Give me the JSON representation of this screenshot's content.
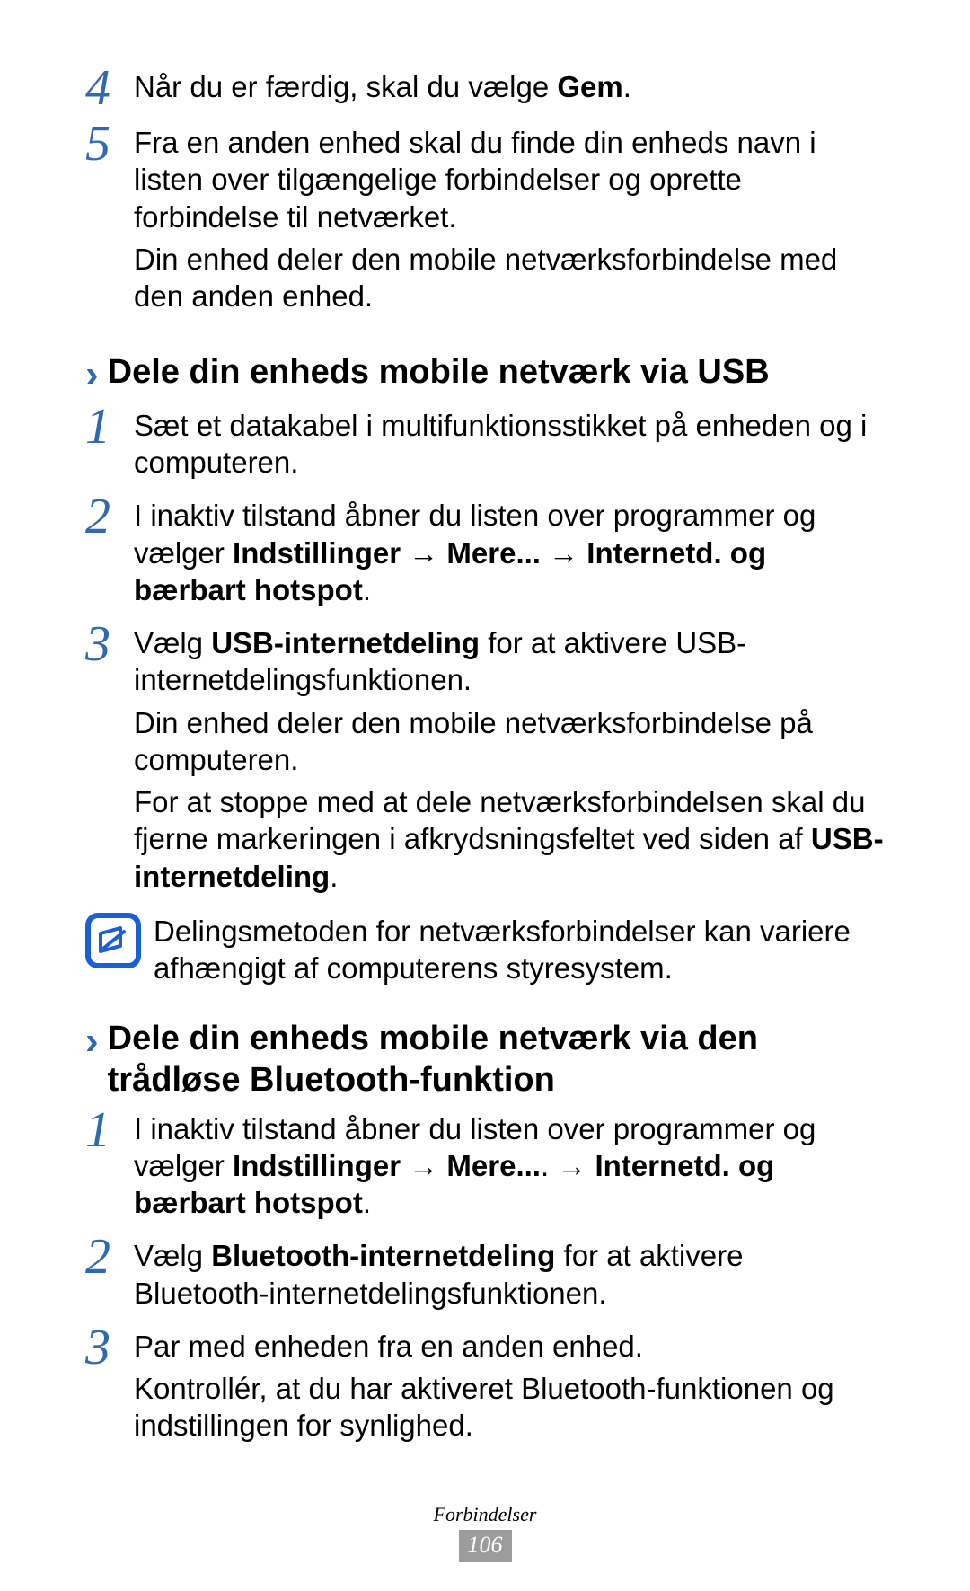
{
  "top_steps": [
    {
      "num": "4",
      "paras": [
        {
          "runs": [
            {
              "t": "Når du er færdig, skal du vælge "
            },
            {
              "t": "Gem",
              "b": true
            },
            {
              "t": "."
            }
          ]
        }
      ]
    },
    {
      "num": "5",
      "paras": [
        {
          "runs": [
            {
              "t": "Fra en anden enhed skal du finde din enheds navn i listen over tilgængelige forbindelser og oprette forbindelse til netværket."
            }
          ]
        },
        {
          "runs": [
            {
              "t": "Din enhed deler den mobile netværksforbindelse med den anden enhed."
            }
          ]
        }
      ]
    }
  ],
  "section1": {
    "title": "Dele din enheds mobile netværk via USB",
    "steps": [
      {
        "num": "1",
        "paras": [
          {
            "runs": [
              {
                "t": "Sæt et datakabel i multifunktionsstikket på enheden og i computeren."
              }
            ]
          }
        ]
      },
      {
        "num": "2",
        "paras": [
          {
            "runs": [
              {
                "t": "I inaktiv tilstand åbner du listen over programmer og vælger "
              },
              {
                "t": "Indstillinger",
                "b": true
              },
              {
                "t": " → "
              },
              {
                "t": "Mere...",
                "b": true
              },
              {
                "t": " → "
              },
              {
                "t": "Internetd. og bærbart hotspot",
                "b": true
              },
              {
                "t": "."
              }
            ]
          }
        ]
      },
      {
        "num": "3",
        "paras": [
          {
            "runs": [
              {
                "t": "Vælg "
              },
              {
                "t": "USB-internetdeling",
                "b": true
              },
              {
                "t": " for at aktivere USB-internetdelingsfunktionen."
              }
            ]
          },
          {
            "runs": [
              {
                "t": "Din enhed deler den mobile netværksforbindelse på computeren."
              }
            ]
          },
          {
            "runs": [
              {
                "t": "For at stoppe med at dele netværksforbindelsen skal du fjerne markeringen i afkrydsningsfeltet ved siden af "
              },
              {
                "t": "USB-internetdeling",
                "b": true
              },
              {
                "t": "."
              }
            ]
          }
        ]
      }
    ],
    "note": "Delingsmetoden for netværksforbindelser kan variere afhængigt af computerens styresystem."
  },
  "section2": {
    "title": "Dele din enheds mobile netværk via den trådløse Bluetooth-funktion",
    "steps": [
      {
        "num": "1",
        "paras": [
          {
            "runs": [
              {
                "t": "I inaktiv tilstand åbner du listen over programmer og vælger "
              },
              {
                "t": "Indstillinger",
                "b": true
              },
              {
                "t": " → "
              },
              {
                "t": "Mere...",
                "b": true
              },
              {
                "t": ". → "
              },
              {
                "t": "Internetd. og bærbart hotspot",
                "b": true
              },
              {
                "t": "."
              }
            ]
          }
        ]
      },
      {
        "num": "2",
        "paras": [
          {
            "runs": [
              {
                "t": "Vælg "
              },
              {
                "t": "Bluetooth-internetdeling",
                "b": true
              },
              {
                "t": " for at aktivere Bluetooth-internetdelingsfunktionen."
              }
            ]
          }
        ]
      },
      {
        "num": "3",
        "paras": [
          {
            "runs": [
              {
                "t": "Par med enheden fra en anden enhed."
              }
            ]
          },
          {
            "runs": [
              {
                "t": "Kontrollér, at du har aktiveret Bluetooth-funktionen og indstillingen for synlighed."
              }
            ]
          }
        ]
      }
    ]
  },
  "footer": {
    "section": "Forbindelser",
    "page": "106"
  }
}
